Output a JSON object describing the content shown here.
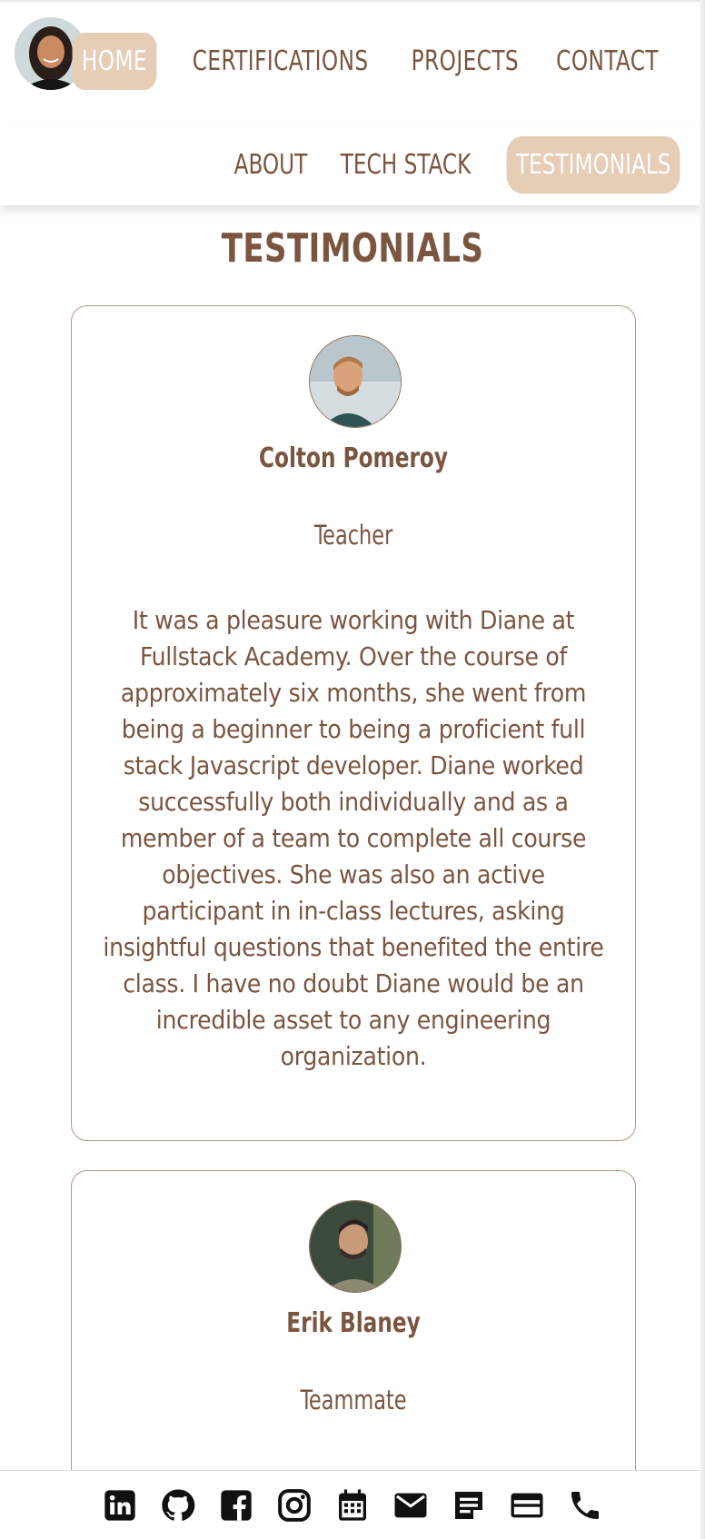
{
  "nav": {
    "main": [
      "HOME",
      "CERTIFICATIONS",
      "PROJECTS",
      "CONTACT"
    ],
    "sub": [
      "ABOUT",
      "TECH STACK",
      "TESTIMONIALS"
    ],
    "active_main": "HOME",
    "active_sub": "TESTIMONIALS"
  },
  "section": {
    "title": "TESTIMONIALS"
  },
  "testimonials": [
    {
      "name": "Colton Pomeroy",
      "role": "Teacher",
      "text": "It was a pleasure working with Diane at Fullstack Academy. Over the course of approximately six months, she went from being a beginner to being a proficient full stack Javascript developer. Diane worked successfully both individually and as a member of a team to complete all course objectives. She was also an active participant in in-class lectures, asking insightful questions that benefited the entire class. I have no doubt Diane would be an incredible asset to any engineering organization."
    },
    {
      "name": "Erik Blaney",
      "role": "Teammate",
      "text": ""
    }
  ],
  "footer_icons": [
    "linkedin-icon",
    "github-icon",
    "facebook-icon",
    "instagram-icon",
    "calendar-icon",
    "email-icon",
    "notes-icon",
    "credit-card-icon",
    "phone-icon"
  ],
  "colors": {
    "accent": "#e6cdb6",
    "text": "#7a5540",
    "border": "#b59784"
  }
}
